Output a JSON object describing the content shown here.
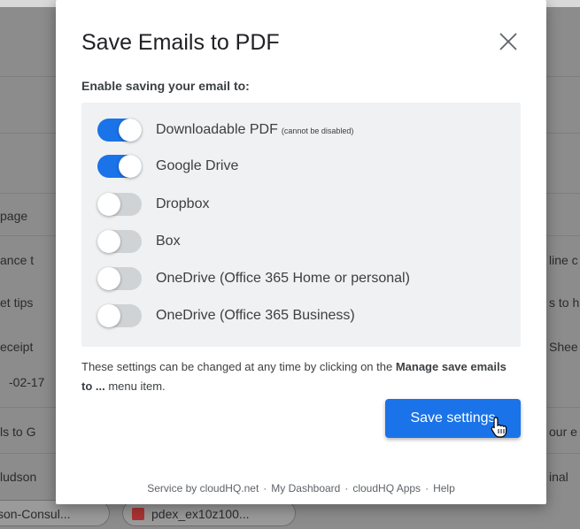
{
  "dialog": {
    "title": "Save Emails to PDF",
    "subtitle": "Enable saving your email to:",
    "options": [
      {
        "label": "Downloadable PDF",
        "note": "(cannot be disabled)",
        "enabled": true
      },
      {
        "label": "Google Drive",
        "note": "",
        "enabled": true
      },
      {
        "label": "Dropbox",
        "note": "",
        "enabled": false
      },
      {
        "label": "Box",
        "note": "",
        "enabled": false
      },
      {
        "label": "OneDrive (Office 365 Home or personal)",
        "note": "",
        "enabled": false
      },
      {
        "label": "OneDrive (Office 365 Business)",
        "note": "",
        "enabled": false
      }
    ],
    "info_text_1": "These settings can be changed at any time by clicking on the ",
    "info_bold": "Manage save emails to ...",
    "info_text_2": " menu item.",
    "save_label": "Save settings",
    "footer": {
      "service": "Service by cloudHQ.net",
      "dashboard": "My Dashboard",
      "apps": "cloudHQ Apps",
      "help": "Help",
      "separator": "·"
    }
  },
  "background": {
    "left_texts": [
      "page",
      "ance t",
      "et tips",
      "eceipt",
      "-02-17",
      "ls to G",
      "ludson"
    ],
    "right_texts": [
      "line c",
      "s to h",
      "Shee",
      "our e",
      "inal"
    ],
    "chips": [
      "son-Consul...",
      "pdex_ex10z100..."
    ]
  },
  "colors": {
    "accent": "#1a73e8",
    "toggle_off": "#d0d3d6",
    "options_bg": "#eff1f3"
  }
}
